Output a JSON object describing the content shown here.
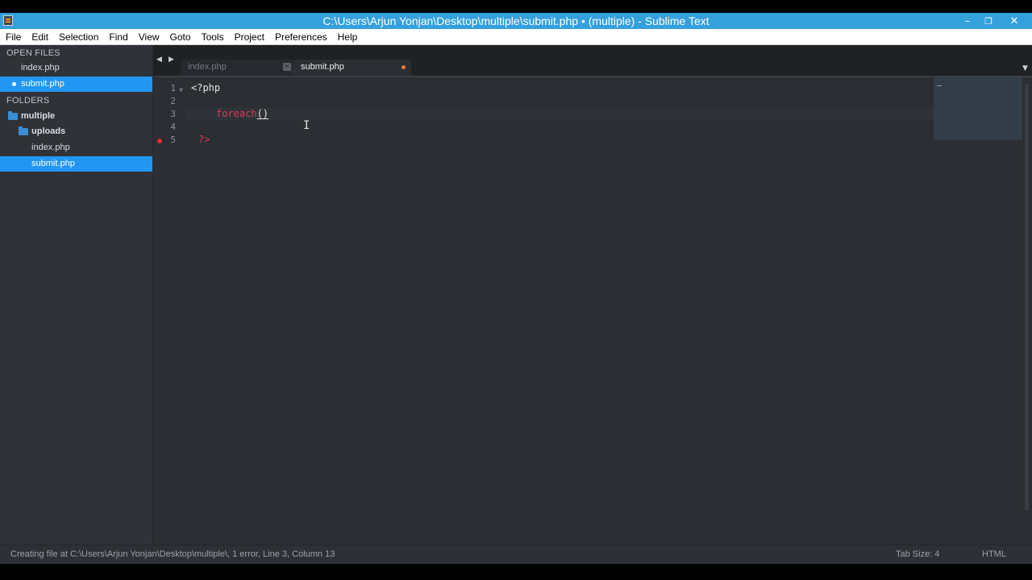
{
  "window": {
    "title": "C:\\Users\\Arjun Yonjan\\Desktop\\multiple\\submit.php • (multiple) - Sublime Text",
    "minimize_glyph": "–",
    "maximize_glyph": "❐",
    "close_glyph": "✕"
  },
  "menubar": {
    "items": [
      "File",
      "Edit",
      "Selection",
      "Find",
      "View",
      "Goto",
      "Tools",
      "Project",
      "Preferences",
      "Help"
    ]
  },
  "sidebar": {
    "open_files_header": "OPEN FILES",
    "open_files": [
      {
        "label": "index.php",
        "selected": false,
        "dirty": false
      },
      {
        "label": "submit.php",
        "selected": true,
        "dirty": true
      }
    ],
    "folders_header": "FOLDERS",
    "folders": [
      {
        "label": "multiple",
        "type": "folder"
      },
      {
        "label": "uploads",
        "type": "folder"
      },
      {
        "label": "index.php",
        "type": "file"
      },
      {
        "label": "submit.php",
        "type": "file",
        "selected": true
      }
    ]
  },
  "tabs": {
    "nav_prev": "◀",
    "nav_next": "▶",
    "items": [
      {
        "label": "index.php",
        "active": false,
        "close_glyph": "✕"
      },
      {
        "label": "submit.php",
        "active": true,
        "dirty": true
      }
    ],
    "dropdown_glyph": "▼"
  },
  "editor": {
    "line_numbers": [
      "1",
      "2",
      "3",
      "4",
      "5"
    ],
    "fold_glyph": "▼",
    "lines": {
      "l1": "<?php",
      "l3_keyword": "foreach",
      "l3_paren": "()",
      "l5": "?>"
    },
    "cursor_glyph": "I",
    "error_line": 5
  },
  "statusbar": {
    "message": "Creating file at C:\\Users\\Arjun Yonjan\\Desktop\\multiple\\, 1 error, Line 3, Column 13",
    "tab_size": "Tab Size: 4",
    "syntax": "HTML"
  },
  "colors": {
    "titlebar": "#34a0dc",
    "selection": "#2196f3",
    "keyword": "#e0385c",
    "error": "#e0312f",
    "dirty": "#e8763a"
  }
}
